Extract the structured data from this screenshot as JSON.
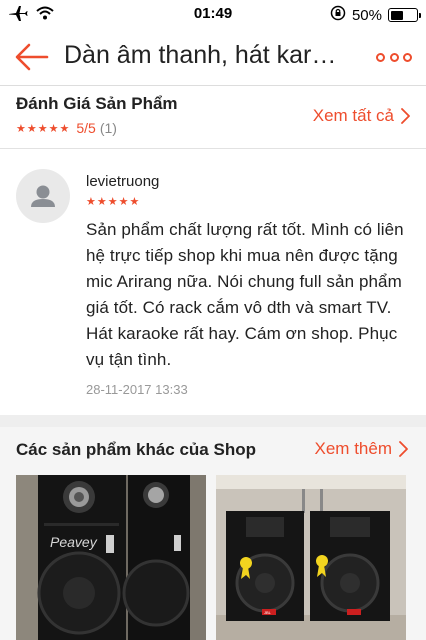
{
  "status_bar": {
    "time": "01:49",
    "battery_percent": "50%",
    "battery_level": 0.5
  },
  "nav": {
    "title": "Dàn âm thanh, hát kar…"
  },
  "rating_summary": {
    "title": "Đánh Giá Sản Phẩm",
    "stars": 5,
    "score": "5/5",
    "count": "(1)",
    "see_all_label": "Xem tất cả"
  },
  "review": {
    "username": "levietruong",
    "stars": 5,
    "text": "Sản phẩm chất lượng rất tốt. Mình có liên hệ trực tiếp shop khi mua nên được tặng mic Arirang nữa. Nói chung full sản phẩm giá tốt. Có rack cắm vô dth và smart TV. Hát karaoke rất hay. Cám ơn shop. Phục vụ tận tình.",
    "date": "28-11-2017 13:33"
  },
  "other_products": {
    "title": "Các sản phẩm khác của Shop",
    "more_label": "Xem thêm",
    "items": [
      {
        "brand_text": "Peavey"
      },
      {
        "brand_text": "JBL"
      }
    ]
  },
  "colors": {
    "accent": "#ee4d2d",
    "text": "#222222",
    "muted": "#999999",
    "divider": "#eeeeee"
  }
}
